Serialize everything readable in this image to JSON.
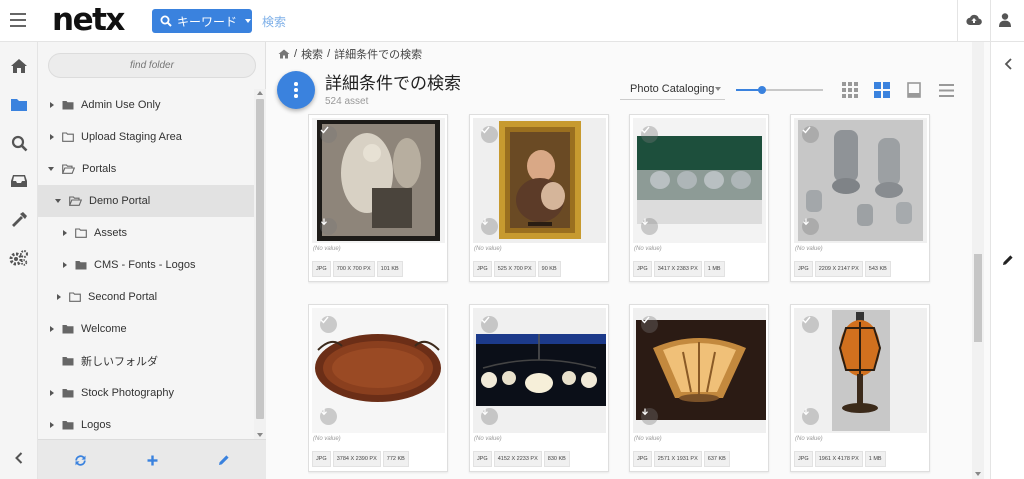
{
  "app": {
    "logo": "netx"
  },
  "header": {
    "keyword_button": "キーワード",
    "search_link": "検索",
    "cloud_icon": "cloud-upload-icon",
    "user_icon": "user-icon"
  },
  "rail": {
    "items": [
      "home-icon",
      "folder-icon",
      "search-icon",
      "inbox-icon",
      "tools-icon",
      "settings-icon",
      "chevron-left-icon"
    ]
  },
  "folders": {
    "find_placeholder": "find folder",
    "tree": [
      {
        "label": "Admin Use Only"
      },
      {
        "label": "Upload Staging Area"
      },
      {
        "label": "Portals"
      },
      {
        "label": "Demo Portal"
      },
      {
        "label": "Assets"
      },
      {
        "label": "CMS - Fonts - Logos"
      },
      {
        "label": "Second Portal"
      },
      {
        "label": "Welcome"
      },
      {
        "label": "新しいフォルダ"
      },
      {
        "label": "Stock Photography"
      },
      {
        "label": "Logos"
      }
    ],
    "footer": [
      "refresh-icon",
      "plus-icon",
      "pencil-icon"
    ]
  },
  "main": {
    "breadcrumb": [
      "/",
      "検索",
      "/",
      "詳細条件での検索"
    ],
    "title": "詳細条件での検索",
    "asset_count": "524 asset",
    "view_select": "Photo Cataloging",
    "zoom_level": 0.3,
    "assets": [
      {
        "caption": "(No value)",
        "type": "JPG",
        "dims": "700 X 700 PX",
        "size": "101 KB"
      },
      {
        "caption": "(No value)",
        "type": "JPG",
        "dims": "525 X 700 PX",
        "size": "90 KB"
      },
      {
        "caption": "(No value)",
        "type": "JPG",
        "dims": "3417 X 2383 PX",
        "size": "1 MB"
      },
      {
        "caption": "(No value)",
        "type": "JPG",
        "dims": "2209 X 2147 PX",
        "size": "543 KB"
      },
      {
        "caption": "(No value)",
        "type": "JPG",
        "dims": "3784 X 2390 PX",
        "size": "772 KB"
      },
      {
        "caption": "(No value)",
        "type": "JPG",
        "dims": "4152 X 2233 PX",
        "size": "830 KB"
      },
      {
        "caption": "(No value)",
        "type": "JPG",
        "dims": "2571 X 1931 PX",
        "size": "637 KB"
      },
      {
        "caption": "(No value)",
        "type": "JPG",
        "dims": "1961 X 4178 PX",
        "size": "1 MB"
      }
    ]
  },
  "colors": {
    "accent": "#3a82de",
    "panel": "#f5f5f5"
  }
}
